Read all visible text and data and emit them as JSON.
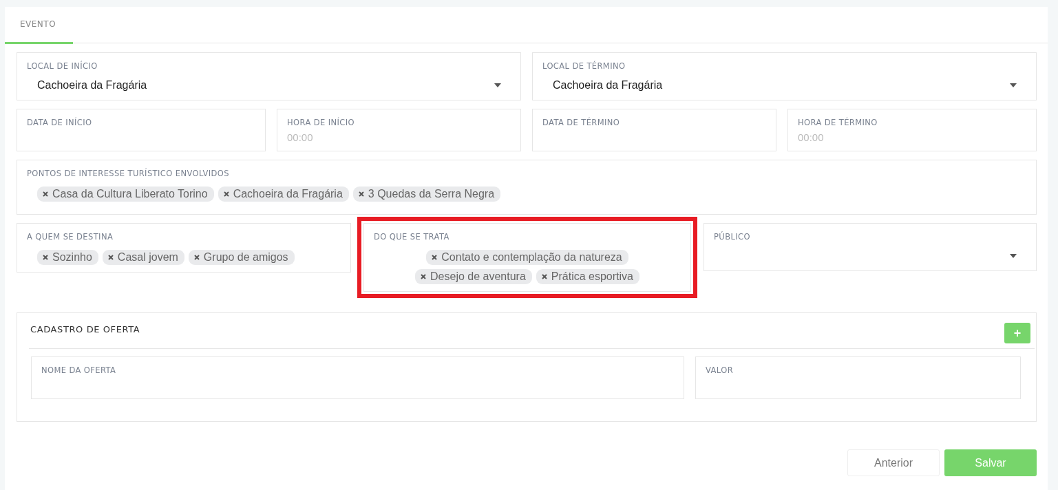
{
  "tabs": [
    {
      "label": "EVENTO",
      "selected": true
    }
  ],
  "rows": [
    [
      {
        "kind": "select",
        "label": "LOCAL DE INÍCIO",
        "value": "Cachoeira da Fragária"
      },
      {
        "kind": "select",
        "label": "LOCAL DE TÉRMINO",
        "value": "Cachoeira da Fragária"
      }
    ],
    [
      {
        "kind": "input",
        "label": "DATA DE INÍCIO"
      },
      {
        "kind": "input",
        "label": "HORA DE INÍCIO",
        "placeholder": "00:00"
      },
      {
        "kind": "input",
        "label": "DATA DE TÉRMINO"
      },
      {
        "kind": "input",
        "label": "HORA DE TÉRMINO",
        "placeholder": "00:00"
      }
    ],
    [
      {
        "kind": "tags",
        "label": "PONTOS DE INTERESSE TURÍSTICO ENVOLVIDOS",
        "tags": [
          "Casa da Cultura Liberato Torino",
          "Cachoeira da Fragária",
          "3 Quedas da Serra Negra"
        ]
      }
    ],
    [
      {
        "kind": "tags",
        "label": "A QUEM SE DESTINA",
        "tags": [
          "Sozinho",
          "Casal jovem",
          "Grupo de amigos"
        ]
      },
      {
        "kind": "tags",
        "label": "DO QUE SE TRATA",
        "highlighted": true,
        "tags": [
          "Contato e contemplação da natureza",
          "Desejo de aventura",
          "Prática esportiva"
        ]
      },
      {
        "kind": "select",
        "label": "PÚBLICO"
      }
    ]
  ],
  "offer": {
    "title": "CADASTRO DE OFERTA",
    "add_button": "+",
    "fields": [
      {
        "kind": "input",
        "label": "NOME DA OFERTA"
      },
      {
        "kind": "input",
        "label": "VALOR"
      }
    ]
  },
  "buttons": [
    {
      "label": "Anterior",
      "kind": "secondary"
    },
    {
      "label": "Salvar",
      "kind": "primary"
    }
  ]
}
